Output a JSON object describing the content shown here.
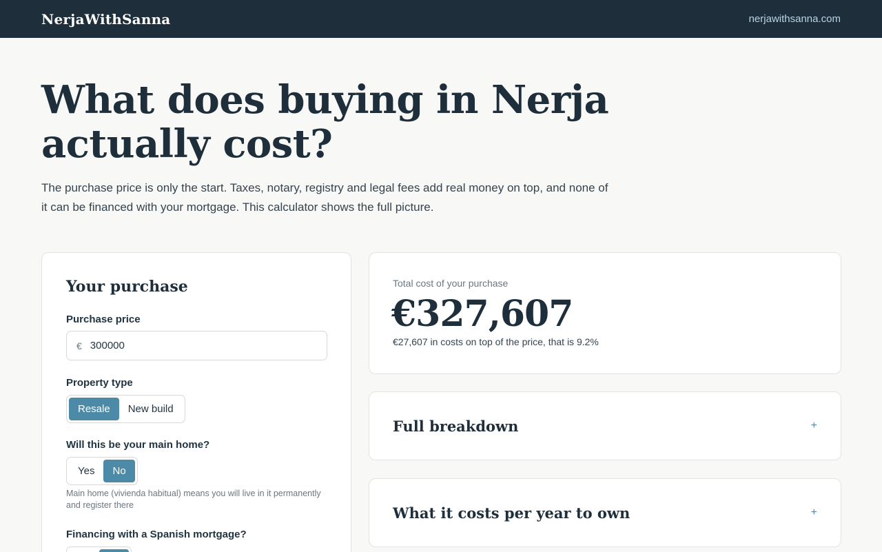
{
  "header": {
    "brand": "NerjaWithSanna",
    "site_link": "nerjawithsanna.com"
  },
  "hero": {
    "title": "What does buying in Nerja actually cost?",
    "subtitle": "The purchase price is only the start. Taxes, notary, registry and legal fees add real money on top, and none of it can be financed with your mortgage. This calculator shows the full picture."
  },
  "purchase_form": {
    "title": "Your purchase",
    "price_label": "Purchase price",
    "currency_symbol": "€",
    "price_value": "300000",
    "property_type_label": "Property type",
    "property_type_options": [
      "Resale",
      "New build"
    ],
    "property_type_selected": "Resale",
    "main_home_label": "Will this be your main home?",
    "main_home_options": [
      "Yes",
      "No"
    ],
    "main_home_selected": "No",
    "main_home_helper": "Main home (vivienda habitual) means you will live in it permanently and register there",
    "financing_label": "Financing with a Spanish mortgage?"
  },
  "results": {
    "total_label": "Total cost of your purchase",
    "total_value": "€327,607",
    "total_note": "€27,607 in costs on top of the price, that is 9.2%",
    "accordions": [
      {
        "title": "Full breakdown",
        "icon": "plus-icon",
        "symbol": "+"
      },
      {
        "title": "What it costs per year to own",
        "icon": "plus-icon",
        "symbol": "+"
      }
    ]
  },
  "colors": {
    "header_bg": "#1e2f3b",
    "accent": "#4d8aa7",
    "page_bg": "#f8f8f7"
  }
}
